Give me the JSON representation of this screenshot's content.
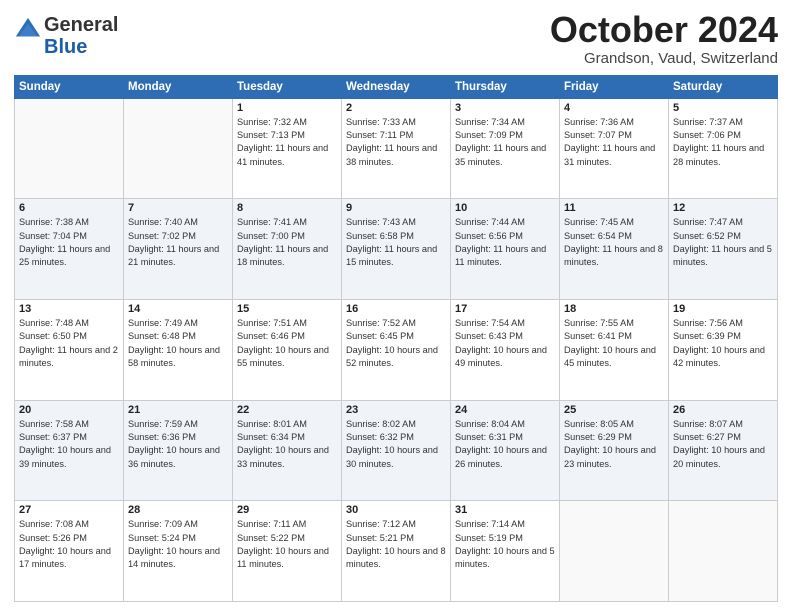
{
  "header": {
    "logo_general": "General",
    "logo_blue": "Blue",
    "month_title": "October 2024",
    "location": "Grandson, Vaud, Switzerland"
  },
  "weekdays": [
    "Sunday",
    "Monday",
    "Tuesday",
    "Wednesday",
    "Thursday",
    "Friday",
    "Saturday"
  ],
  "weeks": [
    [
      {
        "day": "",
        "sunrise": "",
        "sunset": "",
        "daylight": ""
      },
      {
        "day": "",
        "sunrise": "",
        "sunset": "",
        "daylight": ""
      },
      {
        "day": "1",
        "sunrise": "Sunrise: 7:32 AM",
        "sunset": "Sunset: 7:13 PM",
        "daylight": "Daylight: 11 hours and 41 minutes."
      },
      {
        "day": "2",
        "sunrise": "Sunrise: 7:33 AM",
        "sunset": "Sunset: 7:11 PM",
        "daylight": "Daylight: 11 hours and 38 minutes."
      },
      {
        "day": "3",
        "sunrise": "Sunrise: 7:34 AM",
        "sunset": "Sunset: 7:09 PM",
        "daylight": "Daylight: 11 hours and 35 minutes."
      },
      {
        "day": "4",
        "sunrise": "Sunrise: 7:36 AM",
        "sunset": "Sunset: 7:07 PM",
        "daylight": "Daylight: 11 hours and 31 minutes."
      },
      {
        "day": "5",
        "sunrise": "Sunrise: 7:37 AM",
        "sunset": "Sunset: 7:06 PM",
        "daylight": "Daylight: 11 hours and 28 minutes."
      }
    ],
    [
      {
        "day": "6",
        "sunrise": "Sunrise: 7:38 AM",
        "sunset": "Sunset: 7:04 PM",
        "daylight": "Daylight: 11 hours and 25 minutes."
      },
      {
        "day": "7",
        "sunrise": "Sunrise: 7:40 AM",
        "sunset": "Sunset: 7:02 PM",
        "daylight": "Daylight: 11 hours and 21 minutes."
      },
      {
        "day": "8",
        "sunrise": "Sunrise: 7:41 AM",
        "sunset": "Sunset: 7:00 PM",
        "daylight": "Daylight: 11 hours and 18 minutes."
      },
      {
        "day": "9",
        "sunrise": "Sunrise: 7:43 AM",
        "sunset": "Sunset: 6:58 PM",
        "daylight": "Daylight: 11 hours and 15 minutes."
      },
      {
        "day": "10",
        "sunrise": "Sunrise: 7:44 AM",
        "sunset": "Sunset: 6:56 PM",
        "daylight": "Daylight: 11 hours and 11 minutes."
      },
      {
        "day": "11",
        "sunrise": "Sunrise: 7:45 AM",
        "sunset": "Sunset: 6:54 PM",
        "daylight": "Daylight: 11 hours and 8 minutes."
      },
      {
        "day": "12",
        "sunrise": "Sunrise: 7:47 AM",
        "sunset": "Sunset: 6:52 PM",
        "daylight": "Daylight: 11 hours and 5 minutes."
      }
    ],
    [
      {
        "day": "13",
        "sunrise": "Sunrise: 7:48 AM",
        "sunset": "Sunset: 6:50 PM",
        "daylight": "Daylight: 11 hours and 2 minutes."
      },
      {
        "day": "14",
        "sunrise": "Sunrise: 7:49 AM",
        "sunset": "Sunset: 6:48 PM",
        "daylight": "Daylight: 10 hours and 58 minutes."
      },
      {
        "day": "15",
        "sunrise": "Sunrise: 7:51 AM",
        "sunset": "Sunset: 6:46 PM",
        "daylight": "Daylight: 10 hours and 55 minutes."
      },
      {
        "day": "16",
        "sunrise": "Sunrise: 7:52 AM",
        "sunset": "Sunset: 6:45 PM",
        "daylight": "Daylight: 10 hours and 52 minutes."
      },
      {
        "day": "17",
        "sunrise": "Sunrise: 7:54 AM",
        "sunset": "Sunset: 6:43 PM",
        "daylight": "Daylight: 10 hours and 49 minutes."
      },
      {
        "day": "18",
        "sunrise": "Sunrise: 7:55 AM",
        "sunset": "Sunset: 6:41 PM",
        "daylight": "Daylight: 10 hours and 45 minutes."
      },
      {
        "day": "19",
        "sunrise": "Sunrise: 7:56 AM",
        "sunset": "Sunset: 6:39 PM",
        "daylight": "Daylight: 10 hours and 42 minutes."
      }
    ],
    [
      {
        "day": "20",
        "sunrise": "Sunrise: 7:58 AM",
        "sunset": "Sunset: 6:37 PM",
        "daylight": "Daylight: 10 hours and 39 minutes."
      },
      {
        "day": "21",
        "sunrise": "Sunrise: 7:59 AM",
        "sunset": "Sunset: 6:36 PM",
        "daylight": "Daylight: 10 hours and 36 minutes."
      },
      {
        "day": "22",
        "sunrise": "Sunrise: 8:01 AM",
        "sunset": "Sunset: 6:34 PM",
        "daylight": "Daylight: 10 hours and 33 minutes."
      },
      {
        "day": "23",
        "sunrise": "Sunrise: 8:02 AM",
        "sunset": "Sunset: 6:32 PM",
        "daylight": "Daylight: 10 hours and 30 minutes."
      },
      {
        "day": "24",
        "sunrise": "Sunrise: 8:04 AM",
        "sunset": "Sunset: 6:31 PM",
        "daylight": "Daylight: 10 hours and 26 minutes."
      },
      {
        "day": "25",
        "sunrise": "Sunrise: 8:05 AM",
        "sunset": "Sunset: 6:29 PM",
        "daylight": "Daylight: 10 hours and 23 minutes."
      },
      {
        "day": "26",
        "sunrise": "Sunrise: 8:07 AM",
        "sunset": "Sunset: 6:27 PM",
        "daylight": "Daylight: 10 hours and 20 minutes."
      }
    ],
    [
      {
        "day": "27",
        "sunrise": "Sunrise: 7:08 AM",
        "sunset": "Sunset: 5:26 PM",
        "daylight": "Daylight: 10 hours and 17 minutes."
      },
      {
        "day": "28",
        "sunrise": "Sunrise: 7:09 AM",
        "sunset": "Sunset: 5:24 PM",
        "daylight": "Daylight: 10 hours and 14 minutes."
      },
      {
        "day": "29",
        "sunrise": "Sunrise: 7:11 AM",
        "sunset": "Sunset: 5:22 PM",
        "daylight": "Daylight: 10 hours and 11 minutes."
      },
      {
        "day": "30",
        "sunrise": "Sunrise: 7:12 AM",
        "sunset": "Sunset: 5:21 PM",
        "daylight": "Daylight: 10 hours and 8 minutes."
      },
      {
        "day": "31",
        "sunrise": "Sunrise: 7:14 AM",
        "sunset": "Sunset: 5:19 PM",
        "daylight": "Daylight: 10 hours and 5 minutes."
      },
      {
        "day": "",
        "sunrise": "",
        "sunset": "",
        "daylight": ""
      },
      {
        "day": "",
        "sunrise": "",
        "sunset": "",
        "daylight": ""
      }
    ]
  ]
}
